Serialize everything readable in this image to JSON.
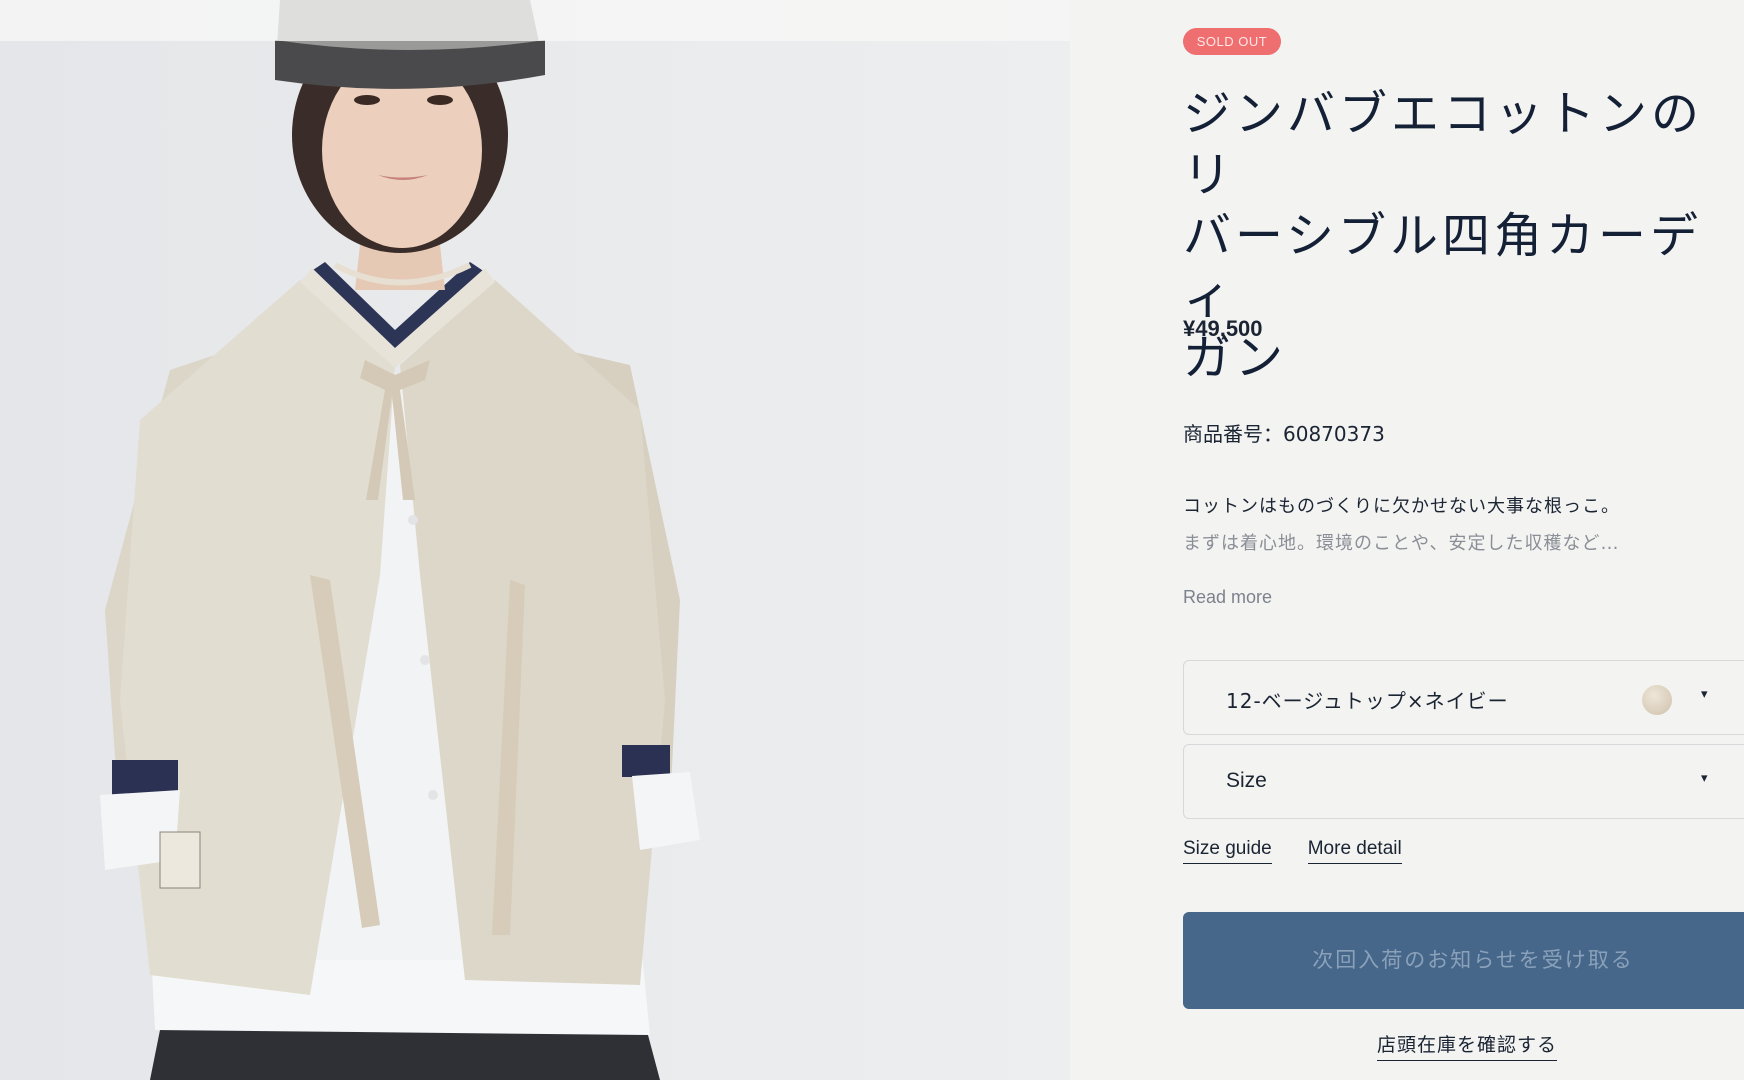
{
  "product": {
    "badge": "SOLD OUT",
    "title_lines": [
      "ジンバブエコットンのリ",
      "バーシブル四角カーディ",
      "ガン"
    ],
    "price": "¥49,500",
    "sku": "商品番号：60870373",
    "description_line1": "コットンはものづくりに欠かせない大事な根っこ。",
    "description_line2": "まずは着心地。環境のことや、安定した収穫など…",
    "read_more": "Read more"
  },
  "options": {
    "color_value": "12-ベージュトップ×ネイビー",
    "size_value": "Size",
    "caret": "▾"
  },
  "links": {
    "size_guide": "Size guide",
    "more_detail": "More detail"
  },
  "actions": {
    "notify_label": "次回入荷のお知らせを受け取る",
    "store_stock_label": "店頭在庫を確認する"
  },
  "colors": {
    "badge": "#ef6f70",
    "button": "#46668a",
    "text": "#1b2433"
  }
}
